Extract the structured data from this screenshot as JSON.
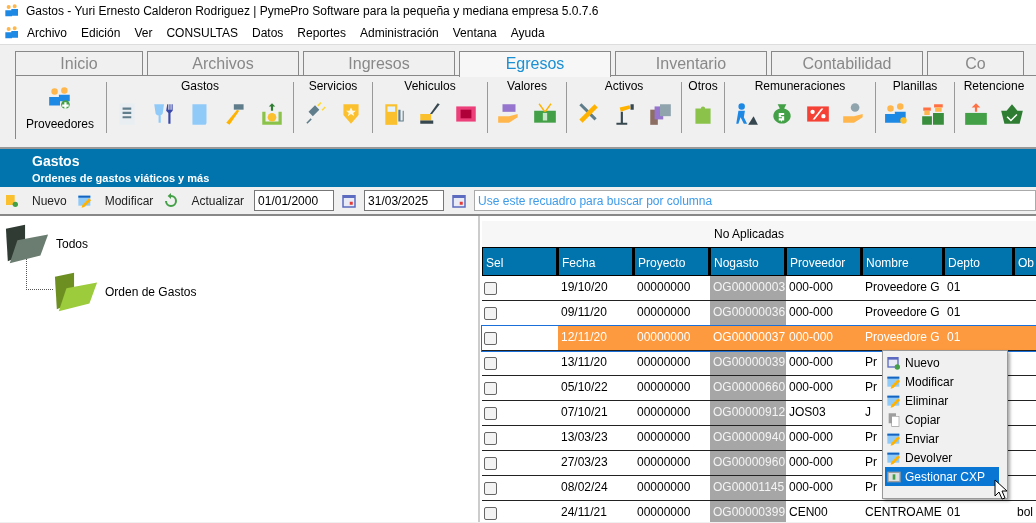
{
  "window": {
    "title": "Gastos - Yuri Ernesto Calderon Rodriguez | PymePro Software para la pequeña y mediana empresa 5.0.7.6"
  },
  "menu": [
    "Archivo",
    "Edición",
    "Ver",
    "CONSULTAS",
    "Datos",
    "Reportes",
    "Administración",
    "Ventana",
    "Ayuda"
  ],
  "tabs": [
    {
      "label": "Inicio",
      "selected": false
    },
    {
      "label": "Archivos",
      "selected": false
    },
    {
      "label": "Ingresos",
      "selected": false
    },
    {
      "label": "Egresos",
      "selected": true
    },
    {
      "label": "Inventario",
      "selected": false
    },
    {
      "label": "Contabilidad",
      "selected": false
    },
    {
      "label": "Co",
      "selected": false
    }
  ],
  "ribbon": {
    "main_button": "Proveedores",
    "groups": [
      {
        "label": "Gastos"
      },
      {
        "label": "Servicios"
      },
      {
        "label": "Vehiculos"
      },
      {
        "label": "Valores"
      },
      {
        "label": "Activos"
      },
      {
        "label": "Otros"
      },
      {
        "label": "Remuneraciones"
      },
      {
        "label": "Planillas"
      },
      {
        "label": "Retencione"
      }
    ]
  },
  "header": {
    "title": "Gastos",
    "subtitle": "Ordenes de gastos viáticos y más"
  },
  "toolbar": {
    "buttons": [
      "Nuevo",
      "Modificar",
      "Actualizar"
    ],
    "date_from": "01/01/2000",
    "date_to": "31/03/2025",
    "search": {
      "placeholder": "Use este recuadro para buscar por columna"
    }
  },
  "tree": [
    {
      "label": "Todos",
      "children": [
        {
          "label": "Orden de Gastos"
        }
      ]
    }
  ],
  "table": {
    "caption": "No Aplicadas",
    "sel_column": "Sel",
    "columns": [
      "Fecha",
      "Proyecto",
      "Nogasto",
      "Proveedor",
      "Nombre",
      "Depto",
      "Ob"
    ],
    "rows": [
      {
        "selected": false,
        "checked": false,
        "cells": [
          "19/10/20",
          "00000000",
          "OG00000003",
          "000-000",
          "Proveedore G",
          "01"
        ]
      },
      {
        "selected": false,
        "checked": false,
        "cells": [
          "09/11/20",
          "00000000",
          "OG00000036",
          "000-000",
          "Proveedore G",
          "01"
        ]
      },
      {
        "selected": true,
        "checked": false,
        "cells": [
          "12/11/20",
          "00000000",
          "OG00000037",
          "000-000",
          "Proveedore G",
          "01"
        ]
      },
      {
        "selected": false,
        "checked": false,
        "cells": [
          "13/11/20",
          "00000000",
          "OG00000039",
          "000-000",
          "Pr"
        ]
      },
      {
        "selected": false,
        "checked": false,
        "cells": [
          "05/10/22",
          "00000000",
          "OG00000660",
          "000-000",
          "Pr"
        ]
      },
      {
        "selected": false,
        "checked": false,
        "cells": [
          "07/10/21",
          "00000000",
          "OG00000912",
          "JOS03",
          "J"
        ]
      },
      {
        "selected": false,
        "checked": false,
        "cells": [
          "13/03/23",
          "00000000",
          "OG00000940",
          "000-000",
          "Pr"
        ]
      },
      {
        "selected": false,
        "checked": false,
        "cells": [
          "27/03/23",
          "00000000",
          "OG00000960",
          "000-000",
          "Pr"
        ]
      },
      {
        "selected": false,
        "checked": false,
        "cells": [
          "08/02/24",
          "00000000",
          "OG00001145",
          "000-000",
          "Pr"
        ]
      },
      {
        "selected": false,
        "checked": false,
        "cells": [
          "24/11/21",
          "00000000",
          "OG00000399",
          "CEN00",
          "CENTROAME",
          "01",
          "bol"
        ]
      }
    ]
  },
  "context_menu": [
    {
      "label": "Nuevo",
      "selected": false
    },
    {
      "label": "Modificar",
      "selected": false
    },
    {
      "label": "Eliminar",
      "selected": false
    },
    {
      "label": "Copiar",
      "selected": false
    },
    {
      "label": "Enviar",
      "selected": false
    },
    {
      "label": "Devolver",
      "selected": false
    },
    {
      "label": "Gestionar CXP",
      "selected": true
    }
  ]
}
